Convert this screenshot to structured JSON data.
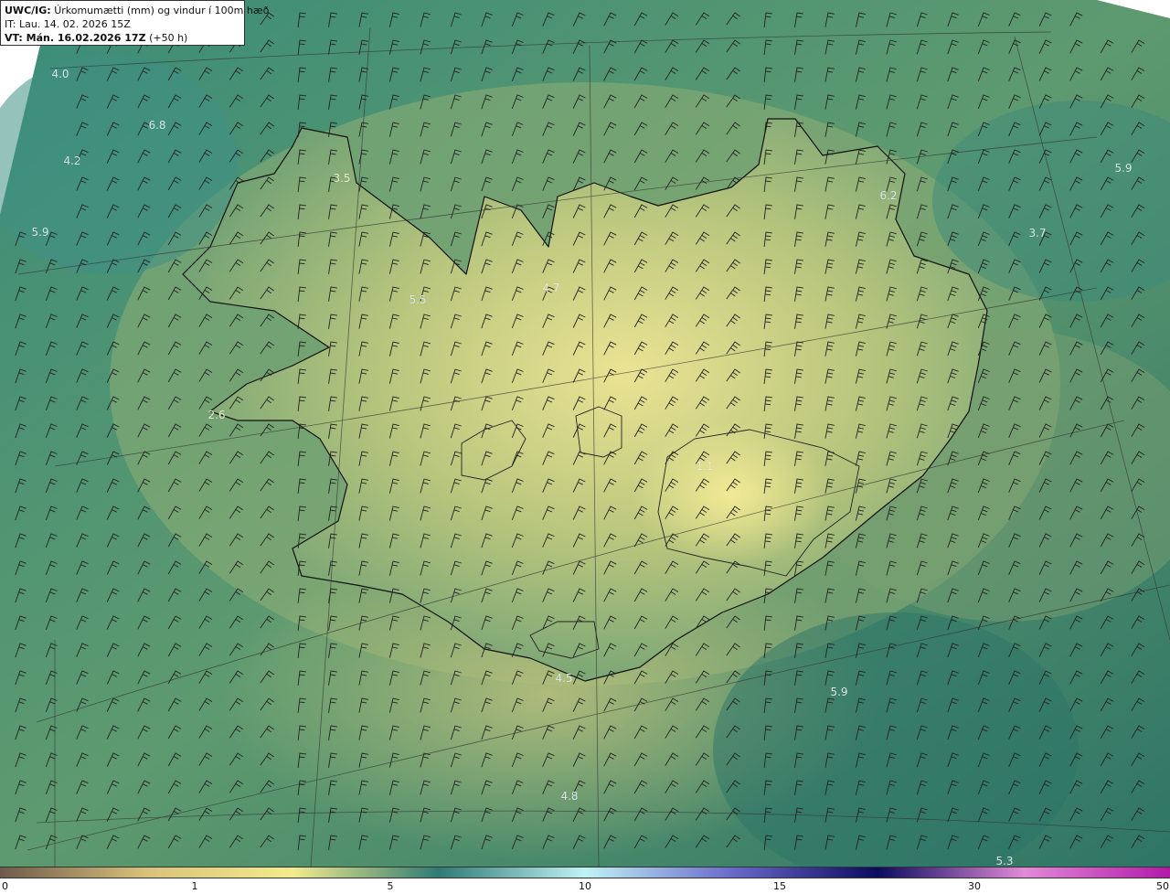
{
  "header": {
    "title_bold": "UWC/IG:",
    "title_rest": "Úrkomumætti (mm) og vindur í 100m hæð",
    "it_line": "IT: Lau. 14. 02. 2026 15Z",
    "vt_bold": "VT: Mán. 16.02.2026 17Z",
    "vt_rest": "(+50 h)"
  },
  "map_labels": [
    "4.0",
    "6.8",
    "4.2",
    "5.9",
    "3.5",
    "5.5",
    "4.7",
    "6.2",
    "5.9",
    "3.7",
    "2.6",
    "1.1",
    "4.5",
    "5.9",
    "4.8",
    "5.3"
  ],
  "colorbar": {
    "ticks": [
      "0",
      "1",
      "5",
      "10",
      "15",
      "30",
      "50"
    ],
    "colors": [
      "#6e5a4a",
      "#d9c27a",
      "#f2ec8c",
      "#2f7a74",
      "#bff3f3",
      "#6a6acb",
      "#0b0b5e",
      "#e28ad7",
      "#b11aa8"
    ]
  },
  "colors": {
    "sea_dark": "#2f7566",
    "land_light": "#e8e08a",
    "coast": "#111111"
  }
}
